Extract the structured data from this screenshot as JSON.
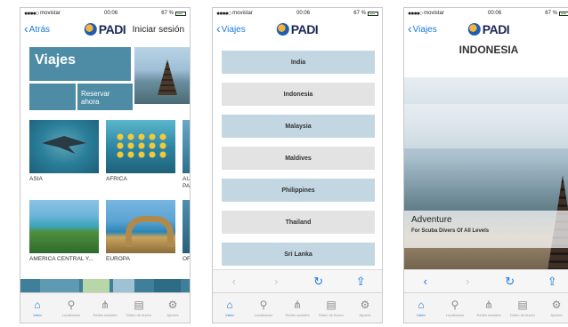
{
  "status": {
    "carrier": "movistar",
    "time": "00:06",
    "battery": "67 %"
  },
  "phone1": {
    "back_label": "Atrás",
    "logo": "PADI",
    "login_label": "Iniciar sesión",
    "title": "Viajes",
    "reservar_label": "Reservar ahora",
    "regions": [
      "ASIA",
      "AFRICA",
      "AU PA",
      "AMERICA CENTRAL Y...",
      "EUROPA",
      "OF"
    ]
  },
  "phone2": {
    "back_label": "Viajes",
    "logo": "PADI",
    "countries": [
      "India",
      "Indonesia",
      "Malaysia",
      "Maldives",
      "Philippines",
      "Thailand",
      "Sri Lanka"
    ]
  },
  "phone3": {
    "back_label": "Viajes",
    "logo": "PADI",
    "title": "INDONESIA",
    "hero_title": "Adventure",
    "hero_subtitle": "For Scuba Divers Of All Levels"
  },
  "tabs": [
    {
      "label": "Inicio",
      "icon": "home-icon"
    },
    {
      "label": "Localizador",
      "icon": "location-pin-icon"
    },
    {
      "label": "Redes sociales",
      "icon": "share-icon"
    },
    {
      "label": "Diario de buceo",
      "icon": "logbook-icon"
    },
    {
      "label": "Ajustes",
      "icon": "gear-icon"
    }
  ],
  "colors": {
    "accent": "#1a7ae0",
    "tile": "#4e8ca6",
    "list_blue": "#c2d7e2",
    "list_grey": "#e3e3e3"
  }
}
